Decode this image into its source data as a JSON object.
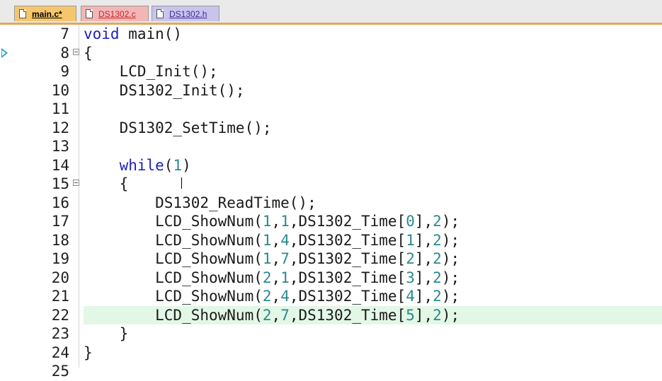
{
  "tabs": [
    {
      "label": "main.c*",
      "active": true,
      "color": "#f6c66e"
    },
    {
      "label": "DS1302.c",
      "active": false,
      "color": "#f3b6b6"
    },
    {
      "label": "DS1302.h",
      "active": false,
      "color": "#c9c4ec"
    }
  ],
  "editor": {
    "lines": [
      {
        "num": "7",
        "segments": [
          {
            "t": "void",
            "c": "kw"
          },
          {
            "t": " main()"
          }
        ]
      },
      {
        "num": "8",
        "segments": [
          {
            "t": "{"
          }
        ],
        "fold": true,
        "marker": true
      },
      {
        "num": "9",
        "segments": [
          {
            "t": "    LCD_Init();"
          }
        ]
      },
      {
        "num": "10",
        "segments": [
          {
            "t": "    DS1302_Init();"
          }
        ]
      },
      {
        "num": "11",
        "segments": []
      },
      {
        "num": "12",
        "segments": [
          {
            "t": "    DS1302_SetTime();"
          }
        ]
      },
      {
        "num": "13",
        "segments": []
      },
      {
        "num": "14",
        "segments": [
          {
            "t": "    "
          },
          {
            "t": "while",
            "c": "kw"
          },
          {
            "t": "("
          },
          {
            "t": "1",
            "c": "numlit"
          },
          {
            "t": ")"
          }
        ]
      },
      {
        "num": "15",
        "segments": [
          {
            "t": "    {"
          }
        ],
        "fold": true
      },
      {
        "num": "16",
        "segments": [
          {
            "t": "        DS1302_ReadTime();"
          }
        ]
      },
      {
        "num": "17",
        "segments": [
          {
            "t": "        LCD_ShowNum("
          },
          {
            "t": "1",
            "c": "numlit"
          },
          {
            "t": ","
          },
          {
            "t": "1",
            "c": "numlit"
          },
          {
            "t": ",DS1302_Time["
          },
          {
            "t": "0",
            "c": "numlit"
          },
          {
            "t": "],"
          },
          {
            "t": "2",
            "c": "numlit"
          },
          {
            "t": ");"
          }
        ]
      },
      {
        "num": "18",
        "segments": [
          {
            "t": "        LCD_ShowNum("
          },
          {
            "t": "1",
            "c": "numlit"
          },
          {
            "t": ","
          },
          {
            "t": "4",
            "c": "numlit"
          },
          {
            "t": ",DS1302_Time["
          },
          {
            "t": "1",
            "c": "numlit"
          },
          {
            "t": "],"
          },
          {
            "t": "2",
            "c": "numlit"
          },
          {
            "t": ");"
          }
        ]
      },
      {
        "num": "19",
        "segments": [
          {
            "t": "        LCD_ShowNum("
          },
          {
            "t": "1",
            "c": "numlit"
          },
          {
            "t": ","
          },
          {
            "t": "7",
            "c": "numlit"
          },
          {
            "t": ",DS1302_Time["
          },
          {
            "t": "2",
            "c": "numlit"
          },
          {
            "t": "],"
          },
          {
            "t": "2",
            "c": "numlit"
          },
          {
            "t": ");"
          }
        ]
      },
      {
        "num": "20",
        "segments": [
          {
            "t": "        LCD_ShowNum("
          },
          {
            "t": "2",
            "c": "numlit"
          },
          {
            "t": ","
          },
          {
            "t": "1",
            "c": "numlit"
          },
          {
            "t": ",DS1302_Time["
          },
          {
            "t": "3",
            "c": "numlit"
          },
          {
            "t": "],"
          },
          {
            "t": "2",
            "c": "numlit"
          },
          {
            "t": ");"
          }
        ]
      },
      {
        "num": "21",
        "segments": [
          {
            "t": "        LCD_ShowNum("
          },
          {
            "t": "2",
            "c": "numlit"
          },
          {
            "t": ","
          },
          {
            "t": "4",
            "c": "numlit"
          },
          {
            "t": ",DS1302_Time["
          },
          {
            "t": "4",
            "c": "numlit"
          },
          {
            "t": "],"
          },
          {
            "t": "2",
            "c": "numlit"
          },
          {
            "t": ");"
          }
        ]
      },
      {
        "num": "22",
        "segments": [
          {
            "t": "        LCD_ShowNum("
          },
          {
            "t": "2",
            "c": "numlit"
          },
          {
            "t": ","
          },
          {
            "t": "7",
            "c": "numlit"
          },
          {
            "t": ",DS1302_Time["
          },
          {
            "t": "5",
            "c": "numlit"
          },
          {
            "t": "],"
          },
          {
            "t": "2",
            "c": "numlit"
          },
          {
            "t": ");"
          }
        ],
        "highlight": true
      },
      {
        "num": "23",
        "segments": [
          {
            "t": "    }"
          }
        ]
      },
      {
        "num": "24",
        "segments": [
          {
            "t": "}"
          }
        ]
      },
      {
        "num": "25",
        "segments": []
      }
    ]
  }
}
